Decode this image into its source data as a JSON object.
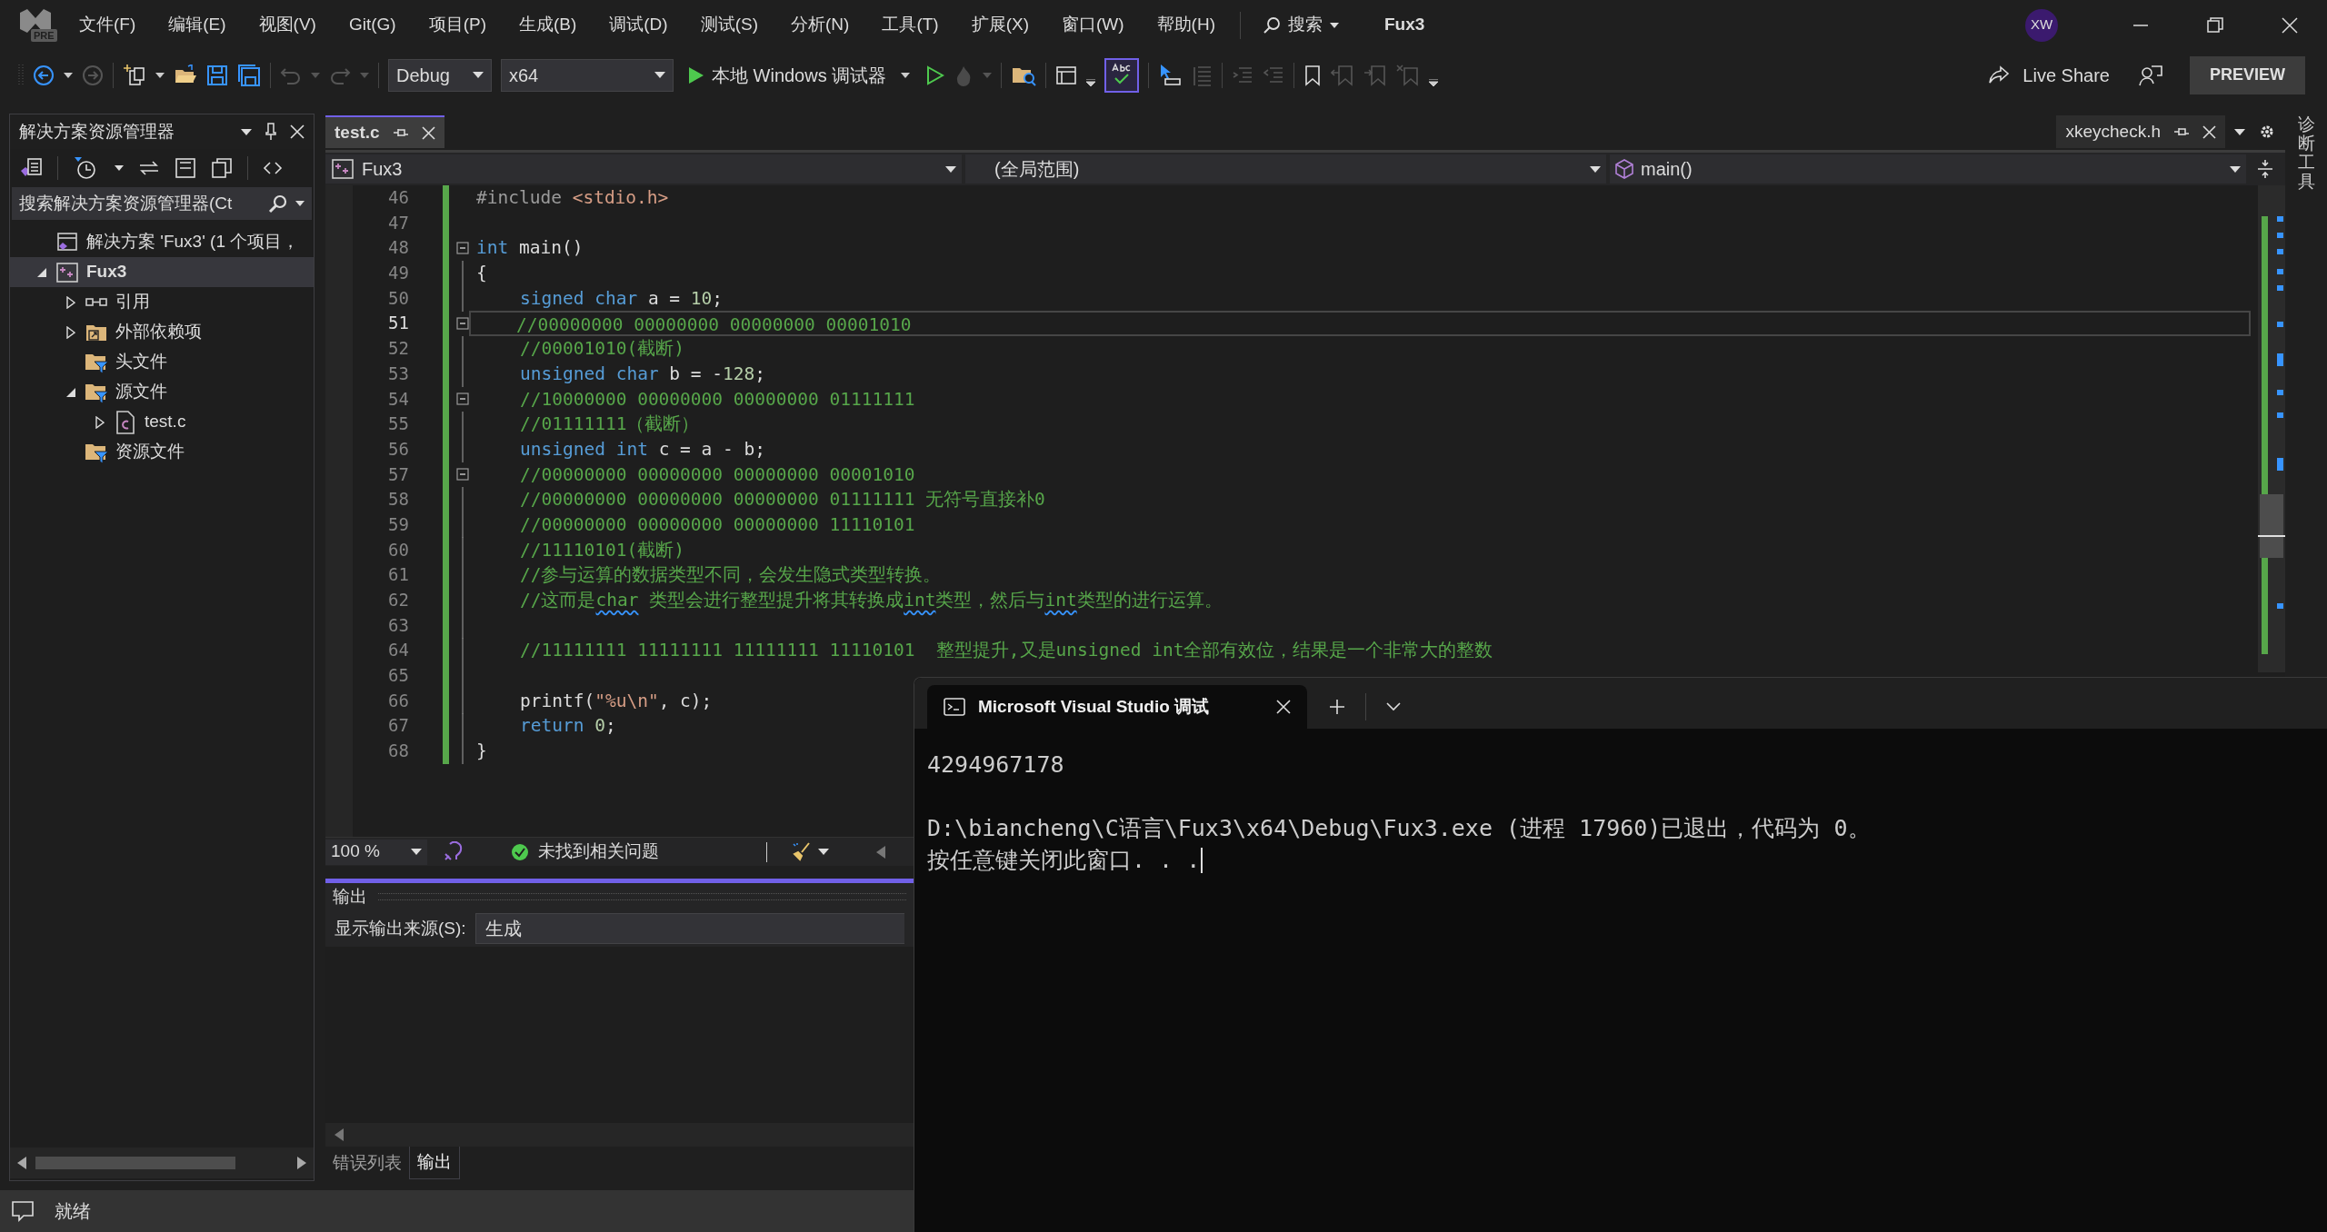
{
  "title_bar": {
    "logo_badge": "PRE",
    "menu": [
      "文件(F)",
      "编辑(E)",
      "视图(V)",
      "Git(G)",
      "项目(P)",
      "生成(B)",
      "调试(D)",
      "测试(S)",
      "分析(N)",
      "工具(T)",
      "扩展(X)",
      "窗口(W)",
      "帮助(H)"
    ],
    "search": "搜索",
    "solution_name": "Fux3",
    "avatar": "XW"
  },
  "toolbar": {
    "configuration": "Debug",
    "platform": "x64",
    "debugger": "本地 Windows 调试器",
    "spell_check_on": true,
    "live_share": "Live Share",
    "preview": "PREVIEW"
  },
  "solution_explorer": {
    "title": "解决方案资源管理器",
    "search_placeholder": "搜索解决方案资源管理器(Ct",
    "items": [
      {
        "label": "解决方案 'Fux3' (1 个项目，",
        "kind": "solution",
        "selected": false
      },
      {
        "label": "Fux3",
        "kind": "project",
        "expanded": true,
        "selected": true,
        "children": [
          {
            "label": "引用",
            "kind": "reference",
            "expanded": false,
            "selected": false
          },
          {
            "label": "外部依赖项",
            "kind": "external",
            "expanded": false,
            "selected": false
          },
          {
            "label": "头文件",
            "kind": "filter",
            "selected": false
          },
          {
            "label": "源文件",
            "kind": "filter",
            "expanded": true,
            "selected": false,
            "children": [
              {
                "label": "test.c",
                "kind": "file",
                "expanded": false,
                "selected": false
              }
            ]
          },
          {
            "label": "资源文件",
            "kind": "filter",
            "selected": false
          }
        ]
      }
    ]
  },
  "editor": {
    "tabs": [
      {
        "label": "test.c",
        "selected": true,
        "kind": "main"
      },
      {
        "label": "xkeycheck.h",
        "selected": false,
        "kind": "separate"
      }
    ],
    "nav": [
      "Fux3",
      "(全局范围)",
      "main()"
    ],
    "lines": [
      {
        "number": "46",
        "foldable": false,
        "current": false,
        "indented": false,
        "segments": [
          {
            "text": "#include",
            "kind": "preprocessor"
          },
          {
            "text": " <stdio.h>",
            "kind": "string"
          }
        ]
      },
      {
        "number": "47"
      },
      {
        "number": "48",
        "foldable": true,
        "current": false,
        "indented": false,
        "segments": [
          {
            "text": "int",
            "kind": "keyword"
          },
          {
            "text": " main()",
            "kind": "plain"
          }
        ]
      },
      {
        "number": "49",
        "foldable": false,
        "current": false,
        "indented": false,
        "segments": [
          {
            "text": "{",
            "kind": "plain"
          }
        ]
      },
      {
        "number": "50",
        "foldable": false,
        "current": false,
        "indented": true,
        "segments": [
          {
            "text": "signed char",
            "kind": "keyword"
          },
          {
            "text": " a = ",
            "kind": "plain"
          },
          {
            "text": "10",
            "kind": "number"
          },
          {
            "text": ";",
            "kind": "plain"
          }
        ]
      },
      {
        "number": "51",
        "foldable": true,
        "current": true,
        "indented": true,
        "segments": [
          {
            "text": "//00000000 00000000 00000000 00001010",
            "kind": "comment"
          }
        ]
      },
      {
        "number": "52",
        "foldable": false,
        "current": false,
        "indented": true,
        "segments": [
          {
            "text": "//00001010(截断)",
            "kind": "comment"
          }
        ]
      },
      {
        "number": "53",
        "foldable": false,
        "current": false,
        "indented": true,
        "segments": [
          {
            "text": "unsigned char",
            "kind": "keyword"
          },
          {
            "text": " b = -",
            "kind": "plain"
          },
          {
            "text": "128",
            "kind": "number"
          },
          {
            "text": ";",
            "kind": "plain"
          }
        ]
      },
      {
        "number": "54",
        "foldable": true,
        "current": false,
        "indented": true,
        "segments": [
          {
            "text": "//10000000 00000000 00000000 01111111",
            "kind": "comment"
          }
        ]
      },
      {
        "number": "55",
        "foldable": false,
        "current": false,
        "indented": true,
        "segments": [
          {
            "text": "//01111111（截断）",
            "kind": "comment"
          }
        ]
      },
      {
        "number": "56",
        "foldable": false,
        "current": false,
        "indented": true,
        "segments": [
          {
            "text": "unsigned int",
            "kind": "keyword"
          },
          {
            "text": " c = a - b;",
            "kind": "plain"
          }
        ]
      },
      {
        "number": "57",
        "foldable": true,
        "current": false,
        "indented": true,
        "segments": [
          {
            "text": "//00000000 00000000 00000000 00001010",
            "kind": "comment"
          }
        ]
      },
      {
        "number": "58",
        "foldable": false,
        "current": false,
        "indented": true,
        "segments": [
          {
            "text": "//00000000 00000000 00000000 01111111 无符号直接补0",
            "kind": "comment"
          }
        ]
      },
      {
        "number": "59",
        "foldable": false,
        "current": false,
        "indented": true,
        "segments": [
          {
            "text": "//00000000 00000000 00000000 11110101",
            "kind": "comment"
          }
        ]
      },
      {
        "number": "60",
        "foldable": false,
        "current": false,
        "indented": true,
        "segments": [
          {
            "text": "//11110101(截断)",
            "kind": "comment"
          }
        ]
      },
      {
        "number": "61",
        "foldable": false,
        "current": false,
        "indented": true,
        "segments": [
          {
            "text": "//参与运算的数据类型不同，会发生隐式类型转换。",
            "kind": "comment"
          }
        ]
      },
      {
        "number": "62",
        "foldable": false,
        "current": false,
        "indented": true,
        "segments": [
          {
            "text": "//这而是",
            "kind": "comment"
          },
          {
            "text": "char",
            "kind": "comment_squiggle"
          },
          {
            "text": " 类型会进行整型提升将其转换成",
            "kind": "comment"
          },
          {
            "text": "int",
            "kind": "comment_squiggle"
          },
          {
            "text": "类型，然后与",
            "kind": "comment"
          },
          {
            "text": "int",
            "kind": "comment_squiggle"
          },
          {
            "text": "类型的进行运算。",
            "kind": "comment"
          }
        ]
      },
      {
        "number": "63"
      },
      {
        "number": "64",
        "foldable": false,
        "current": false,
        "indented": true,
        "segments": [
          {
            "text": "//11111111 11111111 11111111 11110101  整型提升,又是unsigned int全部有效位，结果是一个非常大的整数",
            "kind": "comment"
          }
        ]
      },
      {
        "number": "65"
      },
      {
        "number": "66",
        "foldable": false,
        "current": false,
        "indented": true,
        "segments": [
          {
            "text": "printf(",
            "kind": "plain"
          },
          {
            "text": "\"%u\\n\"",
            "kind": "string"
          },
          {
            "text": ", c);",
            "kind": "plain"
          }
        ]
      },
      {
        "number": "67",
        "foldable": false,
        "current": false,
        "indented": true,
        "segments": [
          {
            "text": "return",
            "kind": "keyword"
          },
          {
            "text": " 0",
            "kind": "number"
          },
          {
            "text": ";",
            "kind": "plain"
          }
        ]
      },
      {
        "number": "68",
        "foldable": false,
        "current": false,
        "indented": false,
        "segments": [
          {
            "text": "}",
            "kind": "plain"
          }
        ]
      }
    ],
    "zoom": "100 %",
    "issues": "未找到相关问题"
  },
  "output": {
    "title": "输出",
    "source_label": "显示输出来源(S):",
    "source": "生成"
  },
  "bottom_tabs": [
    {
      "label": "错误列表",
      "selected": false
    },
    {
      "label": "输出",
      "selected": true
    }
  ],
  "right_rail": "诊断工具",
  "status_bar": "就绪",
  "console": {
    "tab_title": "Microsoft Visual Studio 调试",
    "cursor_visible": true,
    "paragraphs": [
      [
        "4294967178"
      ],
      [
        "D:\\biancheng\\C语言\\Fux3\\x64\\Debug\\Fux3.exe (进程 17960)已退出，代码为 0。",
        "按任意键关闭此窗口. . ."
      ]
    ]
  }
}
